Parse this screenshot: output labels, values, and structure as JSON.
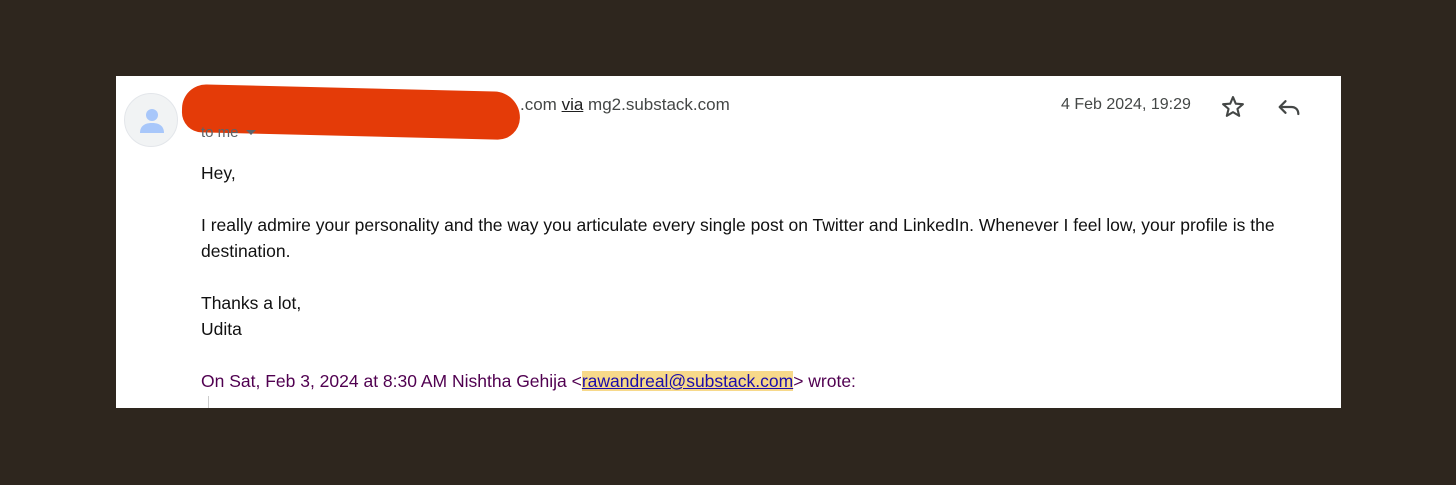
{
  "email": {
    "sender_suffix": ".com",
    "via_label": "via",
    "via_domain": "mg2.substack.com",
    "recipient": "to me",
    "date": "4 Feb 2024, 19:29",
    "greeting": "Hey,",
    "paragraph": "I really admire your personality and the way you articulate every single post on Twitter and LinkedIn. Whenever I feel low, your profile is the destination.",
    "signoff": "Thanks a lot,",
    "signature": "Udita",
    "quote_prefix": "On Sat, Feb 3, 2024 at 8:30 AM Nishtha Gehija <",
    "quote_email": "rawandreal@substack.com",
    "quote_suffix": "> wrote:"
  },
  "icons": {
    "avatar": "person-icon",
    "star": "star-icon",
    "reply": "reply-icon",
    "recipient_details": "chevron-down-icon"
  },
  "colors": {
    "background": "#2e261e",
    "card": "#ffffff",
    "redaction": "#e43b08",
    "quote_text": "#500050",
    "email_highlight": "#f7d98a",
    "link": "#1a0dab"
  }
}
